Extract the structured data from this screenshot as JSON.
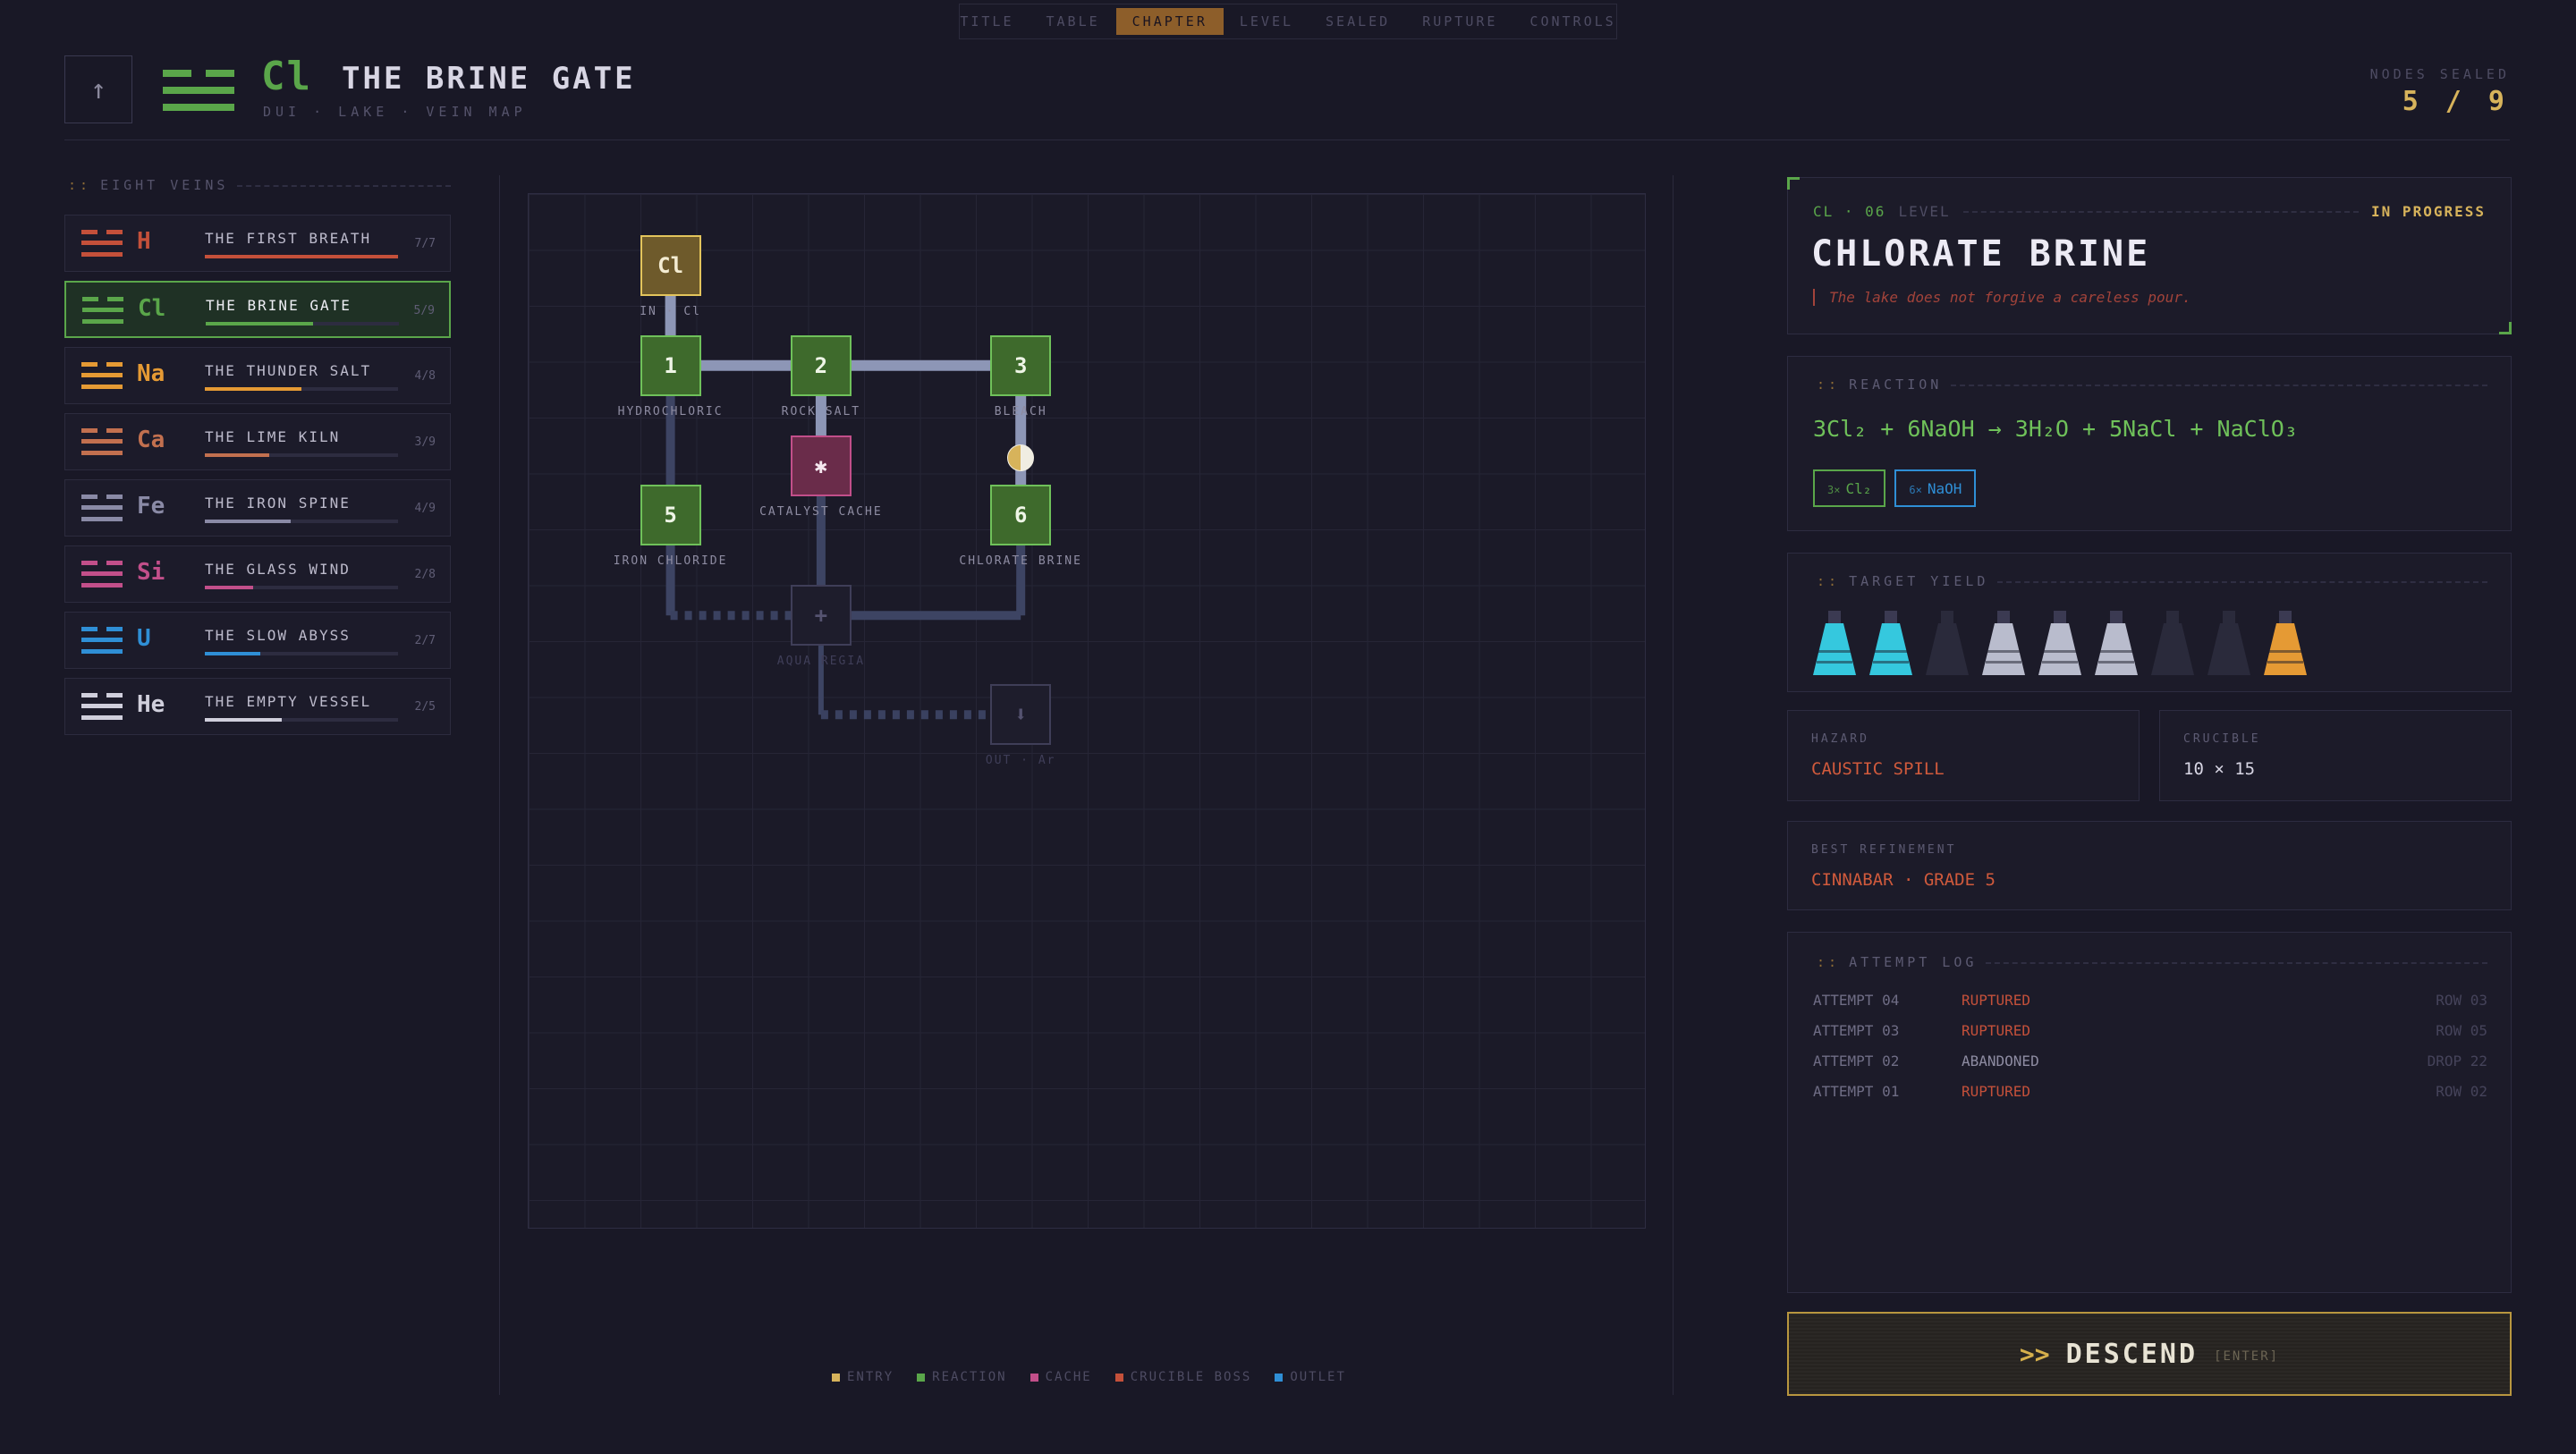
{
  "nav": {
    "tabs": [
      {
        "label": "TITLE",
        "active": false
      },
      {
        "label": "TABLE",
        "active": false
      },
      {
        "label": "CHAPTER",
        "active": true
      },
      {
        "label": "LEVEL",
        "active": false
      },
      {
        "label": "SEALED",
        "active": false
      },
      {
        "label": "RUPTURE",
        "active": false
      },
      {
        "label": "CONTROLS",
        "active": false
      }
    ]
  },
  "header": {
    "back_icon": "arrow-up-icon",
    "symbol": "Cl",
    "title": "THE BRINE GATE",
    "subtitle": "DUI · LAKE · VEIN MAP",
    "nodes_sealed_label": "NODES SEALED",
    "nodes_sealed_value": "5 / 9",
    "accent": "#5aa64a"
  },
  "sidebar": {
    "heading_prefix": "::",
    "heading": "EIGHT VEINS",
    "veins": [
      {
        "symbol": "H",
        "name": "THE FIRST BREATH",
        "count": "7/7",
        "progress": 1.0,
        "color": "#c4503a",
        "active": false
      },
      {
        "symbol": "Cl",
        "name": "THE BRINE GATE",
        "count": "5/9",
        "progress": 0.556,
        "color": "#5aa64a",
        "active": true
      },
      {
        "symbol": "Na",
        "name": "THE THUNDER SALT",
        "count": "4/8",
        "progress": 0.5,
        "color": "#e59a34",
        "active": false
      },
      {
        "symbol": "Ca",
        "name": "THE LIME KILN",
        "count": "3/9",
        "progress": 0.333,
        "color": "#c2704f",
        "active": false
      },
      {
        "symbol": "Fe",
        "name": "THE IRON SPINE",
        "count": "4/9",
        "progress": 0.444,
        "color": "#8a8aa6",
        "active": false
      },
      {
        "symbol": "Si",
        "name": "THE GLASS WIND",
        "count": "2/8",
        "progress": 0.25,
        "color": "#c24f8a",
        "active": false
      },
      {
        "symbol": "U",
        "name": "THE SLOW ABYSS",
        "count": "2/7",
        "progress": 0.286,
        "color": "#2f8fd6",
        "active": false
      },
      {
        "symbol": "He",
        "name": "THE EMPTY VESSEL",
        "count": "2/5",
        "progress": 0.4,
        "color": "#d0cfdc",
        "active": false
      }
    ]
  },
  "map": {
    "nodes": [
      {
        "id": "entry",
        "glyph": "Cl",
        "label": "IN · Cl",
        "kind": "entry"
      },
      {
        "id": "n1",
        "glyph": "1",
        "label": "HYDROCHLORIC",
        "kind": "reaction"
      },
      {
        "id": "n2",
        "glyph": "2",
        "label": "ROCK SALT",
        "kind": "reaction"
      },
      {
        "id": "n3",
        "glyph": "3",
        "label": "BLEACH",
        "kind": "reaction"
      },
      {
        "id": "cache",
        "glyph": "✱",
        "label": "CATALYST CACHE",
        "kind": "cache"
      },
      {
        "id": "n5",
        "glyph": "5",
        "label": "IRON CHLORIDE",
        "kind": "reaction"
      },
      {
        "id": "n6",
        "glyph": "6",
        "label": "CHLORATE BRINE",
        "kind": "reaction"
      },
      {
        "id": "boss",
        "glyph": "+",
        "label": "AQUA REGIA",
        "kind": "locked"
      },
      {
        "id": "outlet",
        "glyph": "⬇",
        "label": "OUT · Ar",
        "kind": "locked"
      }
    ],
    "legend": [
      {
        "label": "ENTRY",
        "color": "#d7b35b"
      },
      {
        "label": "REACTION",
        "color": "#5aa64a"
      },
      {
        "label": "CACHE",
        "color": "#c24f8a"
      },
      {
        "label": "CRUCIBLE BOSS",
        "color": "#c4503a"
      },
      {
        "label": "OUTLET",
        "color": "#2f8fd6"
      }
    ]
  },
  "level": {
    "code": "CL · 06",
    "tag": "LEVEL",
    "status": "IN PROGRESS",
    "title": "CHLORATE BRINE",
    "quote": "The lake does not forgive a careless pour."
  },
  "reaction": {
    "heading": "REACTION",
    "equation": "3Cl₂ + 6NaOH → 3H₂O + 5NaCl + NaClO₃",
    "reagents": [
      {
        "qty": "3×",
        "formula": "Cl₂",
        "color": "#5aa64a"
      },
      {
        "qty": "6×",
        "formula": "NaOH",
        "color": "#2f8fd6"
      }
    ]
  },
  "yield": {
    "heading": "TARGET YIELD",
    "flasks": [
      {
        "color": "#35c8de",
        "filled": true
      },
      {
        "color": "#35c8de",
        "filled": true
      },
      {
        "color": "#2a2a3b",
        "filled": false
      },
      {
        "color": "#b9bccd",
        "filled": true
      },
      {
        "color": "#b9bccd",
        "filled": true
      },
      {
        "color": "#b9bccd",
        "filled": true
      },
      {
        "color": "#2a2a3b",
        "filled": false
      },
      {
        "color": "#2a2a3b",
        "filled": false
      },
      {
        "color": "#e59a34",
        "filled": true
      }
    ]
  },
  "hazard": {
    "label": "HAZARD",
    "value": "CAUSTIC SPILL"
  },
  "crucible": {
    "label": "CRUCIBLE",
    "value": "10 × 15"
  },
  "best": {
    "label": "BEST REFINEMENT",
    "value": "CINNABAR · GRADE 5"
  },
  "log": {
    "heading": "ATTEMPT LOG",
    "rows": [
      {
        "attempt": "ATTEMPT 04",
        "result": "RUPTURED",
        "detail": "ROW 03",
        "color": "#c4503a"
      },
      {
        "attempt": "ATTEMPT 03",
        "result": "RUPTURED",
        "detail": "ROW 05",
        "color": "#c4503a"
      },
      {
        "attempt": "ATTEMPT 02",
        "result": "ABANDONED",
        "detail": "DROP 22",
        "color": "#8e8ca2"
      },
      {
        "attempt": "ATTEMPT 01",
        "result": "RUPTURED",
        "detail": "ROW 02",
        "color": "#c4503a"
      }
    ]
  },
  "descend": {
    "chevron": ">>",
    "label": "DESCEND",
    "key": "[ENTER]"
  }
}
